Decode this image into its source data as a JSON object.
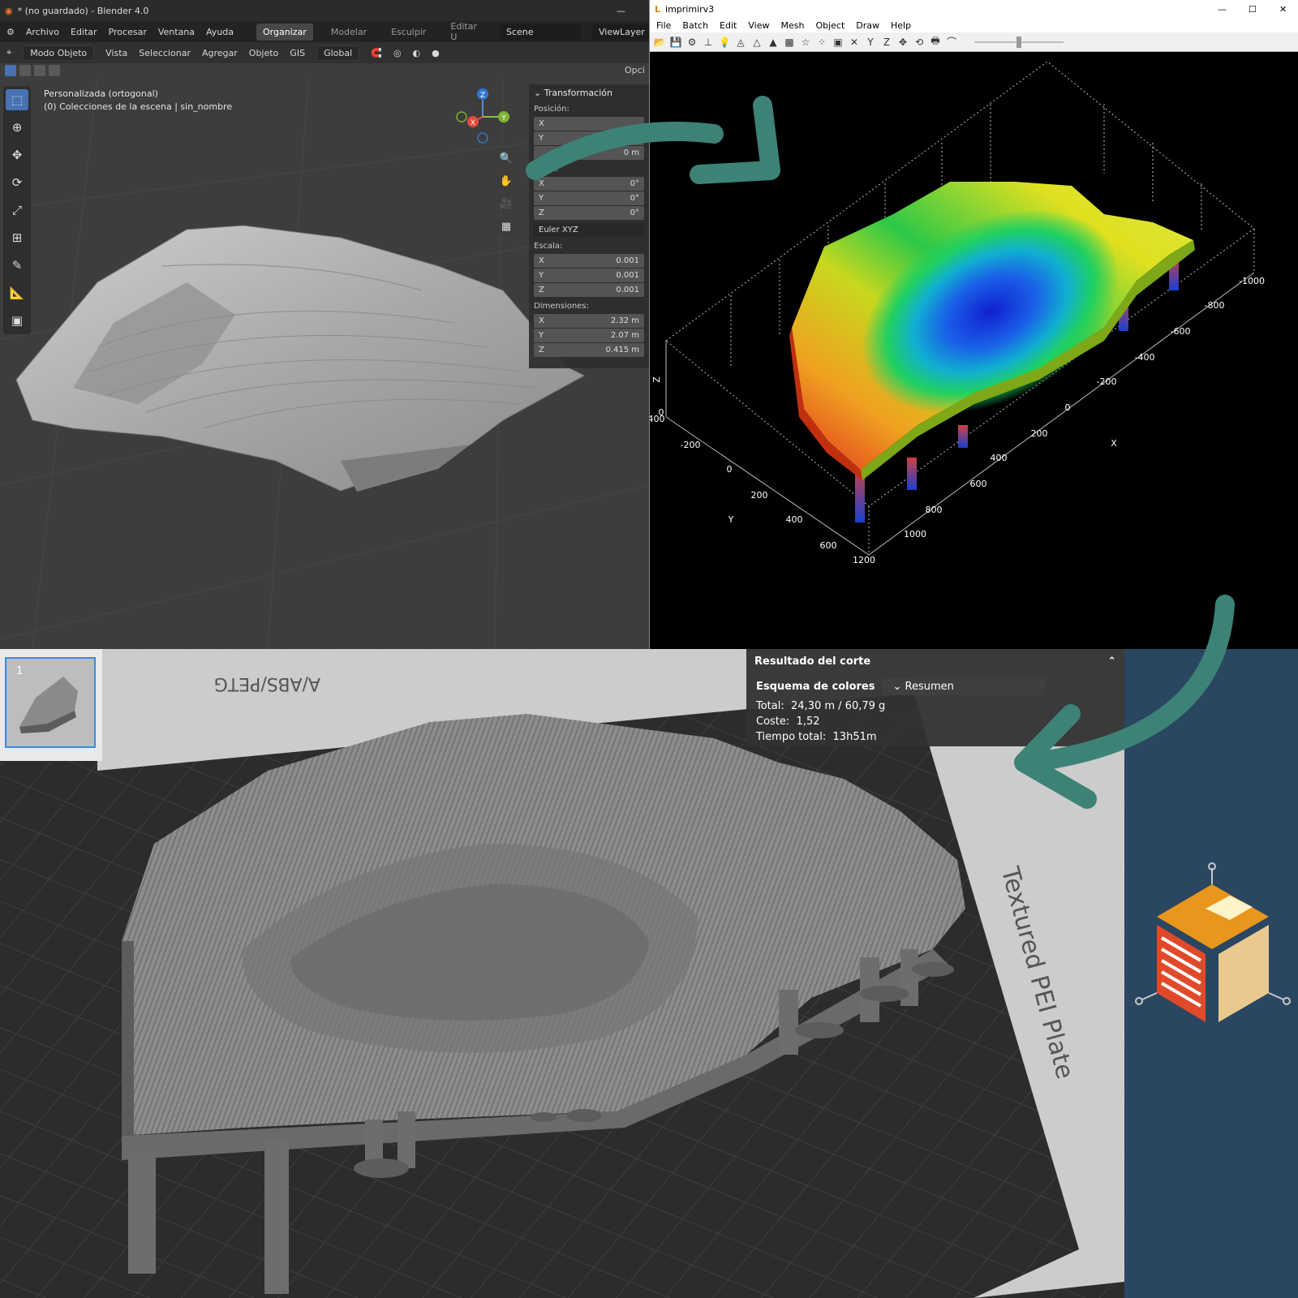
{
  "blender": {
    "title": "* (no guardado) - Blender 4.0",
    "minimize": "—",
    "menu": [
      "Archivo",
      "Editar",
      "Procesar",
      "Ventana",
      "Ayuda"
    ],
    "workspaces": [
      "Organizar",
      "Modelar",
      "Esculpir",
      "Editar U"
    ],
    "scene": "Scene",
    "view_layer": "ViewLayer",
    "header": {
      "mode": "Modo Objeto",
      "items": [
        "Vista",
        "Seleccionar",
        "Agregar",
        "Objeto",
        "GIS"
      ],
      "orientation": "Global",
      "options": "Opci"
    },
    "viewport": {
      "view_name": "Personalizada (ortogonal)",
      "collection": "(0) Colecciones de la escena | sin_nombre"
    },
    "gizmo": {
      "z": "Z",
      "y": "Y",
      "x": "X"
    },
    "npanel": {
      "section": "Transformación",
      "position_label": "Posición:",
      "position": [
        {
          "k": "X",
          "v": ""
        },
        {
          "k": "Y",
          "v": "0 m"
        },
        {
          "k": "",
          "v": "0 m"
        }
      ],
      "rotation_label": "ación:",
      "rotation": [
        {
          "k": "X",
          "v": "0°"
        },
        {
          "k": "Y",
          "v": "0°"
        },
        {
          "k": "Z",
          "v": "0°"
        }
      ],
      "euler": "Euler XYZ",
      "scale_label": "Escala:",
      "scale": [
        {
          "k": "X",
          "v": "0.001"
        },
        {
          "k": "Y",
          "v": "0.001"
        },
        {
          "k": "Z",
          "v": "0.001"
        }
      ],
      "dims_label": "Dimensiones:",
      "dims": [
        {
          "k": "X",
          "v": "2.32 m"
        },
        {
          "k": "Y",
          "v": "2.07 m"
        },
        {
          "k": "Z",
          "v": "0.415 m"
        }
      ]
    }
  },
  "imprimir": {
    "title": "imprimirv3",
    "menu": [
      "File",
      "Batch",
      "Edit",
      "View",
      "Mesh",
      "Object",
      "Draw",
      "Help"
    ],
    "axis": {
      "x_label": "X",
      "y_label": "Y",
      "z_label": "Z",
      "x_ticks": [
        "1200",
        "1000",
        "800",
        "600",
        "400",
        "200",
        "0",
        "-200",
        "-400",
        "-600",
        "-800",
        "-1000"
      ],
      "y_ticks": [
        "600",
        "400",
        "200",
        "0",
        "-200",
        "-400"
      ],
      "z_tick": "0"
    }
  },
  "slicer": {
    "result_title": "Resultado del corte",
    "scheme_label": "Esquema de colores",
    "scheme_value": "Resumen",
    "total_label": "Total:",
    "total_value": "24,30 m / 60,79 g",
    "cost_label": "Coste:",
    "cost_value": "1,52",
    "time_label": "Tiempo total:",
    "time_value": "13h51m",
    "plate_number": "1",
    "bed_text_top": "A/ABS/PETG",
    "bed_text_side": "Textured PEI Plate"
  },
  "colors": {
    "arrow": "#3d8277",
    "side_bg": "#2a4660",
    "logo_orange": "#e8961c",
    "logo_red": "#e04a2a",
    "logo_beige": "#e9c98e"
  }
}
